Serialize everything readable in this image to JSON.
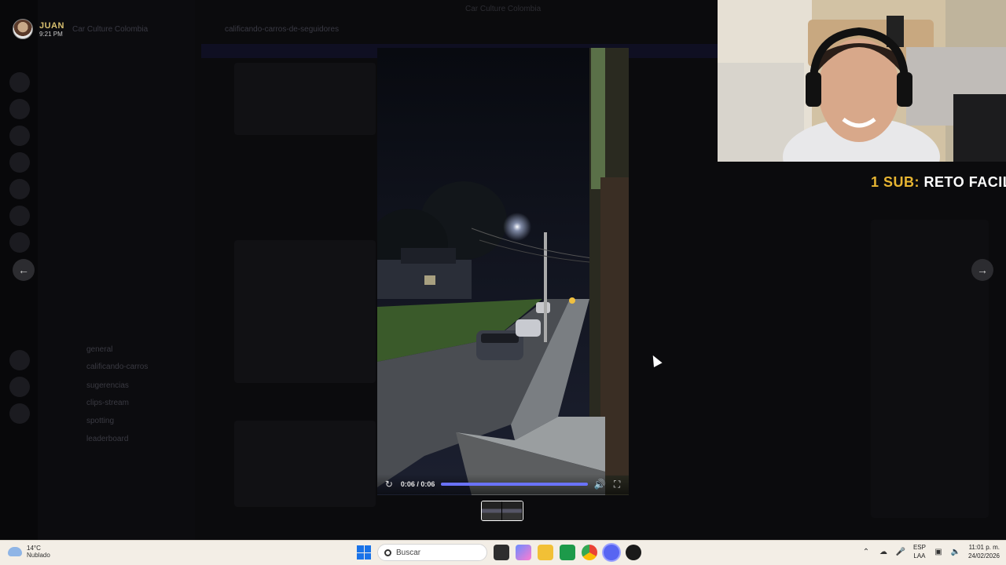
{
  "window": {
    "title": "Car Culture Colombia"
  },
  "streamer": {
    "name": "JUAN",
    "time": "9:21 PM"
  },
  "server": {
    "name": "Car Culture Colombia"
  },
  "channel": {
    "title": "calificando-carros-de-seguidores"
  },
  "channels": [
    "general",
    "calificando-carros",
    "sugerencias",
    "clips-stream",
    "spotting",
    "leaderboard"
  ],
  "video": {
    "time_label": "0:06 / 0:06",
    "progress": 1.0,
    "accent": "#6a73ff"
  },
  "overlay": {
    "sub_prefix": "1 SUB:",
    "sub_goal": "RETO FACIL",
    "prefix_color": "#e7b532"
  },
  "icons": {
    "nav_prev": "arrow-left-icon",
    "nav_next": "arrow-right-icon",
    "replay": "replay-icon",
    "volume": "volume-icon",
    "fullscreen": "fullscreen-icon"
  },
  "taskbar": {
    "weather_temp": "14°C",
    "weather_desc": "Nublado",
    "search_placeholder": "Buscar",
    "lang_top": "ESP",
    "lang_bottom": "LAA",
    "clock_time": "11:01 p. m.",
    "clock_date": "24/02/2026"
  }
}
